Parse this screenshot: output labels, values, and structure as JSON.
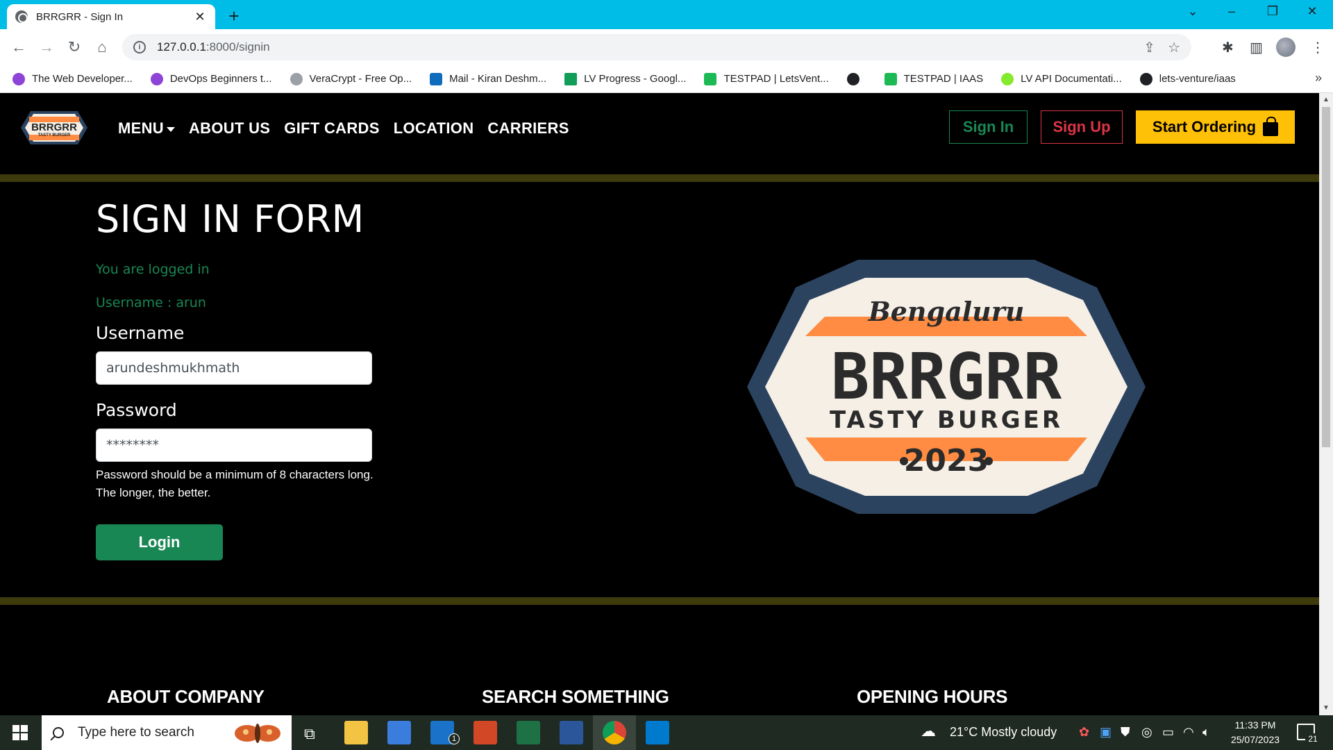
{
  "browser": {
    "tab_title": "BRRGRR - Sign In",
    "tab_close": "✕",
    "new_tab": "+",
    "url_host": "127.0.0.1",
    "url_path": ":8000/signin",
    "bookmarks": [
      {
        "label": "The Web Developer...",
        "color": "#8e44d6"
      },
      {
        "label": "DevOps Beginners t...",
        "color": "#8e44d6"
      },
      {
        "label": "VeraCrypt - Free Op...",
        "color": "#9aa0a6"
      },
      {
        "label": "Mail - Kiran Deshm...",
        "color": "#0f6cbd"
      },
      {
        "label": "LV Progress - Googl...",
        "color": "#0f9d58"
      },
      {
        "label": "TESTPAD | LetsVent...",
        "color": "#1db954"
      },
      {
        "label": "",
        "color": "#202124"
      },
      {
        "label": "TESTPAD | IAAS",
        "color": "#1db954"
      },
      {
        "label": "LV API Documentati...",
        "color": "#85ea2d"
      },
      {
        "label": "lets-venture/iaas",
        "color": "#202124"
      }
    ],
    "bookmarks_more": "»"
  },
  "site": {
    "brand": {
      "top": "Bengaluru",
      "name": "BRRGRR",
      "tagline": "TASTY BURGER",
      "year": "2023"
    },
    "nav": [
      "MENU",
      "ABOUT US",
      "GIFT CARDS",
      "LOCATION",
      "CARRIERS"
    ],
    "sign_in": "Sign In",
    "sign_up": "Sign Up",
    "start_ordering": "Start Ordering",
    "colors": {
      "green": "#198754",
      "red": "#dc3545",
      "yellow": "#ffc107",
      "divider": "#3d3a0c",
      "logo_orange": "#ff8c42",
      "logo_navy": "#2c4360",
      "logo_cream": "#f5efe6"
    }
  },
  "form": {
    "title": "SIGN IN FORM",
    "status": "You are logged in",
    "username_status": "Username : arun",
    "username_label": "Username",
    "username_value": "arundeshmukhmath",
    "password_label": "Password",
    "password_value": "********",
    "password_help": "Password should be a minimum of 8 characters long. The longer, the better.",
    "login": "Login"
  },
  "footer": {
    "about": "ABOUT COMPANY",
    "search": "SEARCH SOMETHING",
    "hours": "OPENING HOURS"
  },
  "taskbar": {
    "search_placeholder": "Type here to search",
    "mail_badge": "1",
    "weather": "21°C  Mostly cloudy",
    "time": "11:33 PM",
    "date": "25/07/2023",
    "notifications": "21"
  }
}
